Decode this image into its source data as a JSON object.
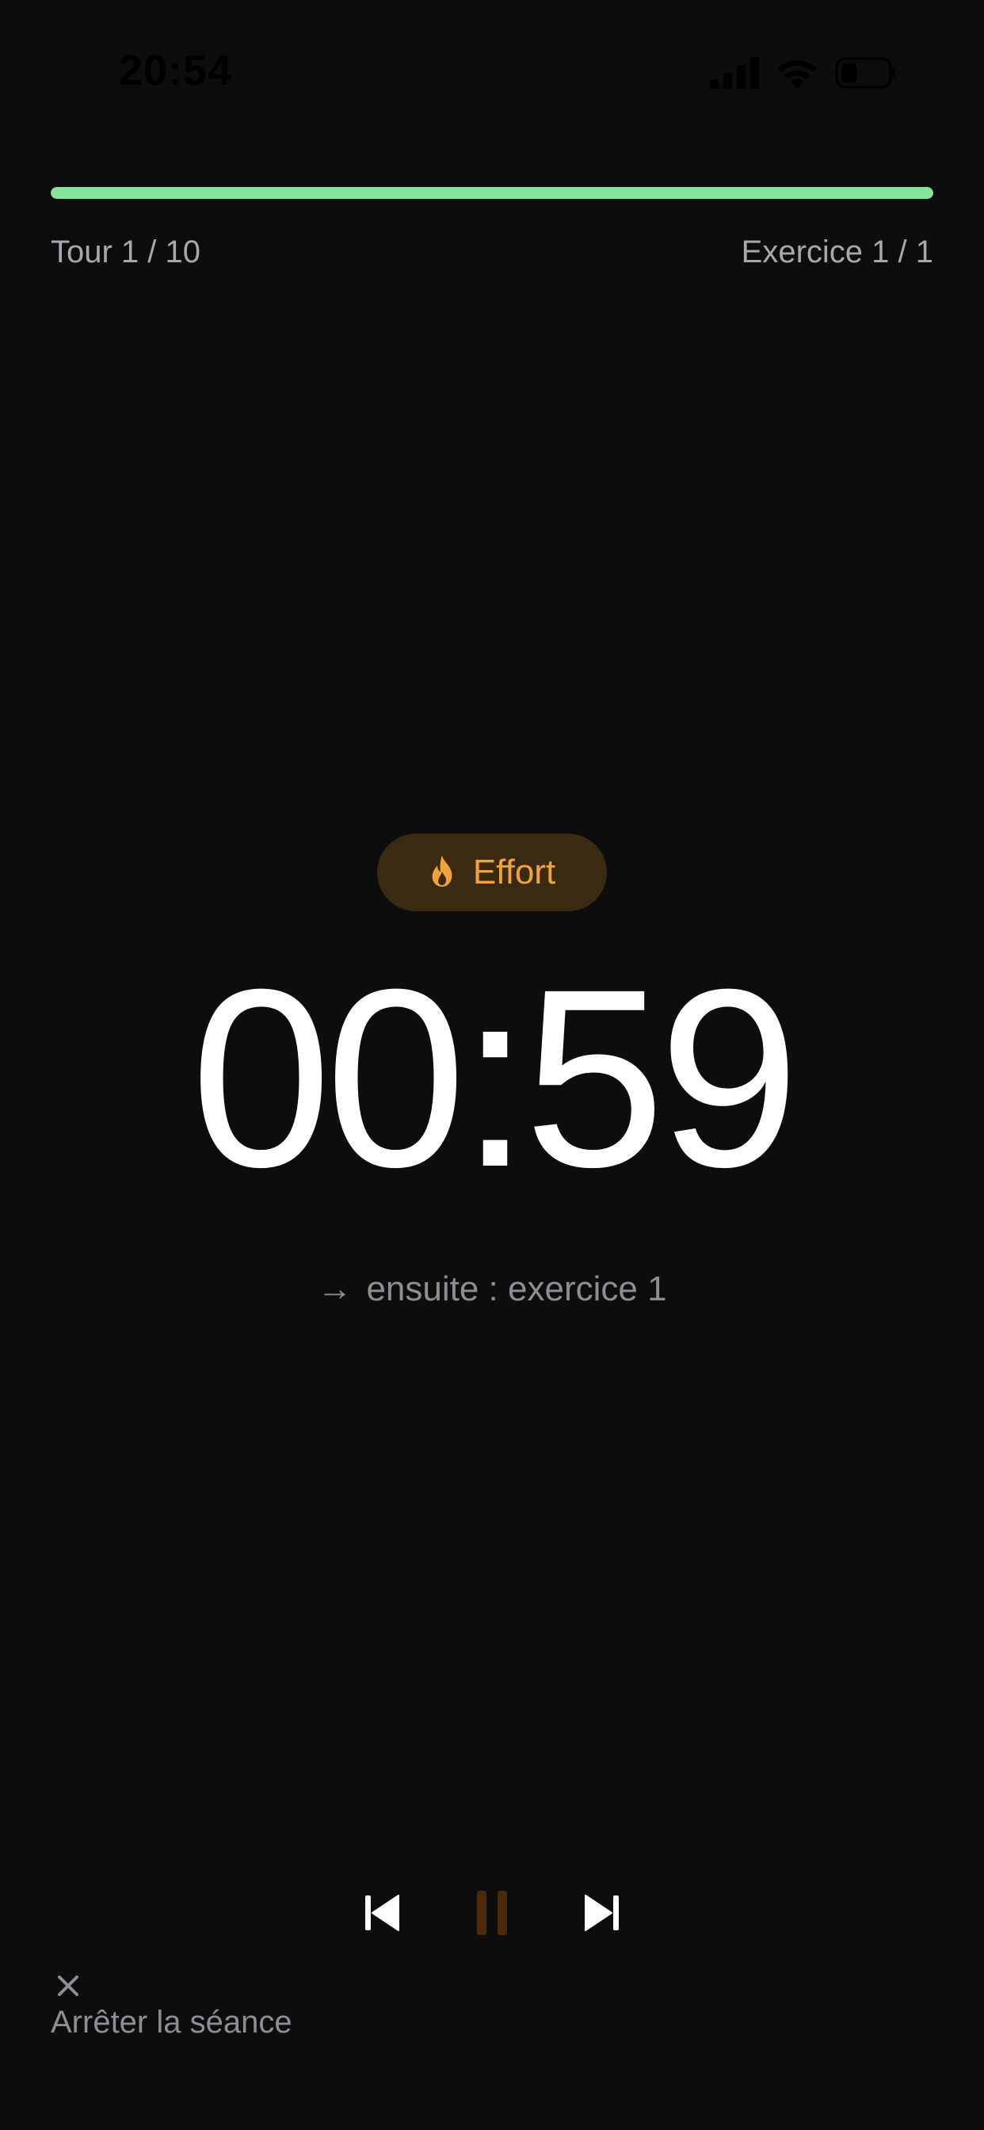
{
  "status_bar": {
    "time": "20:54"
  },
  "session": {
    "progress": 1.0,
    "round_label": "Tour 1 / 10",
    "exercise_label": "Exercice 1 / 1"
  },
  "phase": {
    "label": "Effort",
    "icon": "flame-icon",
    "color": "#f0a33a"
  },
  "timer": {
    "value": "00:59"
  },
  "next": {
    "arrow": "→",
    "text": "ensuite : exercice 1"
  },
  "controls": {
    "previous": "previous-icon",
    "pause": "pause-icon",
    "next": "next-icon"
  },
  "stop": {
    "icon": "×",
    "label": "Arrêter la séance"
  },
  "colors": {
    "background": "#0d0d0d",
    "progress": "#86e39a",
    "accent": "#f0a33a",
    "muted": "#8d8d93"
  }
}
